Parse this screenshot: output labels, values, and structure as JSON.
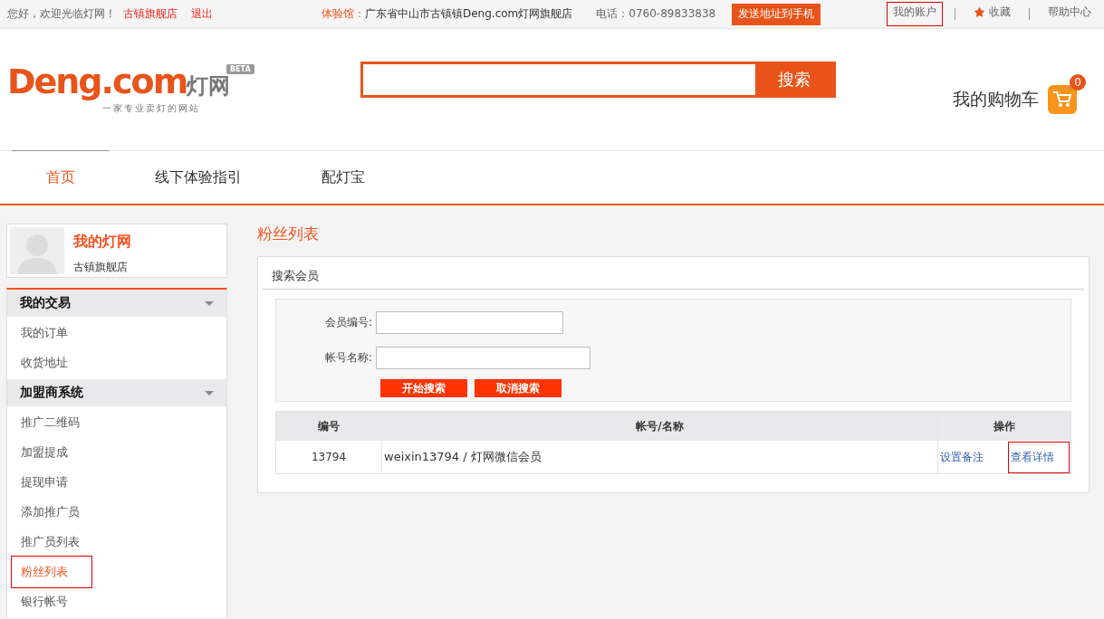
{
  "top_bar": {
    "greeting": "您好，欢迎光临灯网！",
    "user_link": "古镇旗舰店",
    "logout": "退出",
    "showroom_label": "体验馆：",
    "showroom_address": "广东省中山市古镇镇Deng.com灯网旗舰店",
    "phone": "电话：0760-89833838",
    "send_button": "发送地址到手机",
    "links": [
      {
        "label": "我的账户",
        "kind": "plain",
        "highlighted": true
      },
      {
        "label": "收藏",
        "kind": "star",
        "highlighted": false
      },
      {
        "label": "帮助中心",
        "kind": "plain",
        "highlighted": false
      }
    ]
  },
  "logo": {
    "brand": "Deng.com",
    "brand_cn": "灯网",
    "tagline": "一家专业卖灯的网站",
    "badge": "BETA"
  },
  "search": {
    "button": "搜索"
  },
  "cart": {
    "label": "我的购物车",
    "count": "0"
  },
  "nav": [
    {
      "label": "首页",
      "selected": true
    },
    {
      "label": "线下体验指引",
      "selected": false
    },
    {
      "label": "配灯宝",
      "selected": false
    }
  ],
  "profile": {
    "title": "我的灯网",
    "name": "古镇旗舰店"
  },
  "sidebar": [
    {
      "title": "我的交易",
      "items": [
        {
          "label": "我的订单",
          "selected": false,
          "highlighted": false
        },
        {
          "label": "收货地址",
          "selected": false,
          "highlighted": false
        }
      ]
    },
    {
      "title": "加盟商系统",
      "items": [
        {
          "label": "推广二维码",
          "selected": false,
          "highlighted": false
        },
        {
          "label": "加盟提成",
          "selected": false,
          "highlighted": false
        },
        {
          "label": "提现申请",
          "selected": false,
          "highlighted": false
        },
        {
          "label": "添加推广员",
          "selected": false,
          "highlighted": false
        },
        {
          "label": "推广员列表",
          "selected": false,
          "highlighted": false
        },
        {
          "label": "粉丝列表",
          "selected": true,
          "highlighted": true
        },
        {
          "label": "银行帐号",
          "selected": false,
          "highlighted": false
        }
      ]
    }
  ],
  "page_title": "粉丝列表",
  "search_panel": {
    "title": "搜索会员",
    "fields": [
      {
        "label": "会员编号:"
      },
      {
        "label": "帐号名称:"
      }
    ],
    "buttons": [
      "开始搜索",
      "取消搜索"
    ]
  },
  "table": {
    "columns": [
      "编号",
      "帐号/名称",
      "操作"
    ],
    "rows": [
      {
        "id": "13794",
        "name": "weixin13794 / 灯网微信会员",
        "actions": [
          {
            "label": "设置备注",
            "highlighted": false
          },
          {
            "label": "查看详情",
            "highlighted": true
          }
        ]
      }
    ]
  }
}
